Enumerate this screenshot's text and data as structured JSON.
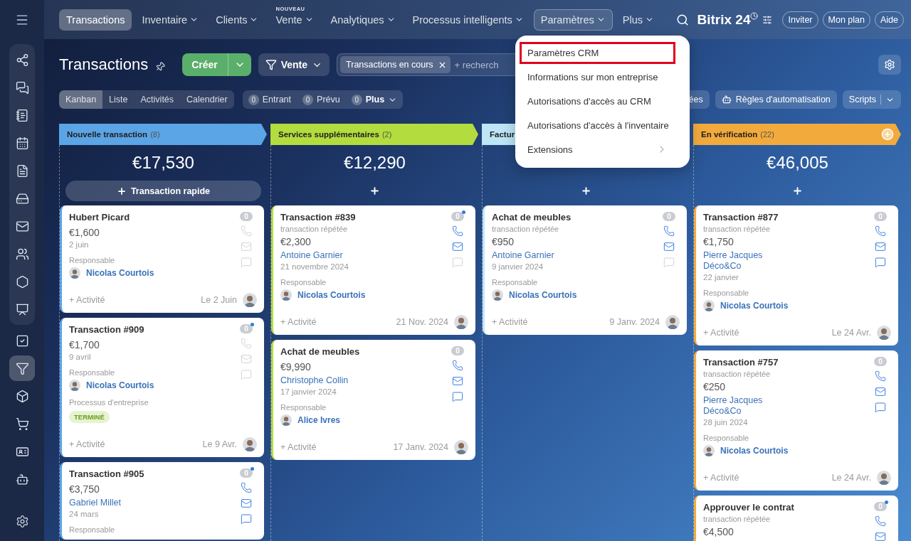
{
  "sidebar": {
    "items": [
      {
        "selected": false
      },
      {
        "selected": false
      },
      {
        "selected": false
      },
      {
        "selected": false
      },
      {
        "selected": false
      },
      {
        "selected": false
      },
      {
        "selected": false
      },
      {
        "selected": false
      },
      {
        "selected": false
      },
      {
        "selected": false
      },
      {
        "selected": false
      },
      {
        "selected": true
      },
      {
        "selected": false
      },
      {
        "selected": false
      },
      {
        "selected": false
      },
      {
        "selected": false
      }
    ]
  },
  "top_nav": {
    "items": [
      {
        "label": "Transactions",
        "selected": true,
        "expanded": false,
        "dropdown": false
      },
      {
        "label": "Inventaire",
        "selected": false,
        "expanded": false,
        "dropdown": true
      },
      {
        "label": "Clients",
        "selected": false,
        "expanded": false,
        "dropdown": true
      },
      {
        "label": "Vente",
        "selected": false,
        "expanded": false,
        "dropdown": true,
        "badge": "NOUVEAU"
      },
      {
        "label": "Analytiques",
        "selected": false,
        "expanded": false,
        "dropdown": true
      },
      {
        "label": "Processus intelligents",
        "selected": false,
        "expanded": false,
        "dropdown": true
      },
      {
        "label": "Paramètres",
        "selected": false,
        "expanded": true,
        "dropdown": true
      },
      {
        "label": "Plus",
        "selected": false,
        "expanded": false,
        "dropdown": true
      }
    ],
    "logo": "Bitrix 24",
    "buttons": [
      "Inviter",
      "Mon plan",
      "Aide"
    ]
  },
  "header": {
    "title": "Transactions",
    "create_button": "Créer",
    "pipeline_button": "Vente",
    "filter": {
      "chip": "Transactions en cours",
      "placeholder": "+ recherch"
    }
  },
  "view_tabs": [
    {
      "label": "Kanban",
      "selected": true
    },
    {
      "label": "Liste",
      "selected": false
    },
    {
      "label": "Activités",
      "selected": false
    },
    {
      "label": "Calendrier",
      "selected": false
    }
  ],
  "counters": [
    {
      "count": "0",
      "label": "Entrant",
      "dropdown": false
    },
    {
      "count": "0",
      "label": "Prévu",
      "dropdown": false
    },
    {
      "count": "0",
      "label": "Plus",
      "dropdown": true
    }
  ],
  "toolbar_buttons": [
    {
      "kind": "plain",
      "label": "ées"
    },
    {
      "kind": "robot",
      "label": "Règles d'automatisation"
    },
    {
      "kind": "split",
      "label": "Scripts"
    }
  ],
  "columns": [
    {
      "title": "Nouvelle transaction",
      "count": "(8)",
      "color": "#5ba4e6",
      "add_icon": false,
      "total": "€17,530",
      "add_label": "Transaction rapide",
      "cards": [
        {
          "title": "Hubert Picard",
          "amount": "€1,600",
          "date": "2 juin",
          "responsible_label": "Responsable",
          "responsible": "Nicolas Courtois",
          "activity": "+ Activité",
          "footer_date": "Le 2 Juin",
          "counter": "0",
          "unread": false,
          "phone": false,
          "mail": false,
          "chat": false
        },
        {
          "title": "Transaction #909",
          "amount": "€1,700",
          "date": "9 avril",
          "responsible_label": "Responsable",
          "responsible": "Nicolas Courtois",
          "process_label": "Processus d'entreprise",
          "process_status": "TERMINÉ",
          "activity": "+ Activité",
          "footer_date": "Le 9 Avr.",
          "counter": "0",
          "unread": true,
          "phone": false,
          "mail": false,
          "chat": false
        },
        {
          "title": "Transaction #905",
          "amount": "€3,750",
          "contacts": [
            "Gabriel Millet"
          ],
          "date": "24 mars",
          "responsible_label": "Responsable",
          "counter": "0",
          "unread": true,
          "phone": true,
          "mail": true,
          "chat": true
        }
      ]
    },
    {
      "title": "Services supplémentaires",
      "count": "(2)",
      "color": "#b3dc3e",
      "add_icon": false,
      "total": "€12,290",
      "cards": [
        {
          "title": "Transaction #839",
          "subtitle": "transaction répétée",
          "amount": "€2,300",
          "contacts": [
            "Antoine Garnier"
          ],
          "date": "21 novembre 2024",
          "responsible_label": "Responsable",
          "responsible": "Nicolas Courtois",
          "activity": "+ Activité",
          "footer_date": "21 Nov. 2024",
          "counter": "0",
          "unread": true,
          "phone": true,
          "mail": true,
          "chat": false
        },
        {
          "title": "Achat de meubles",
          "amount": "€9,990",
          "contacts": [
            "Christophe Collin"
          ],
          "date": "17 janvier 2024",
          "responsible_label": "Responsable",
          "responsible": "Alice Ivres",
          "activity": "+ Activité",
          "footer_date": "17 Janv. 2024",
          "counter": "0",
          "unread": false,
          "phone": true,
          "mail": true,
          "chat": true
        }
      ]
    },
    {
      "title": "Factur",
      "color": "#bde6f7",
      "add_icon": false,
      "cards": [
        {
          "title": "Achat de meubles",
          "subtitle": "transaction répétée",
          "amount": "€950",
          "contacts": [
            "Antoine Garnier"
          ],
          "date": "9 janvier 2024",
          "responsible_label": "Responsable",
          "responsible": "Nicolas Courtois",
          "activity": "+ Activité",
          "footer_date": "9 Janv. 2024",
          "counter": "0",
          "unread": false,
          "phone": true,
          "mail": true,
          "chat": false
        }
      ]
    },
    {
      "title": "En vérification",
      "count": "(22)",
      "color": "#f2aa3c",
      "add_icon": true,
      "total": "€46,005",
      "cards": [
        {
          "title": "Transaction #877",
          "subtitle": "transaction répétée",
          "amount": "€1,750",
          "contacts": [
            "Pierre Jacques",
            "Déco&Co"
          ],
          "date": "22 janvier",
          "responsible_label": "Responsable",
          "responsible": "Nicolas Courtois",
          "activity": "+ Activité",
          "footer_date": "Le 24 Avr.",
          "counter": "0",
          "unread": false,
          "phone": true,
          "mail": true,
          "chat": true
        },
        {
          "title": "Transaction #757",
          "subtitle": "transaction répétée",
          "amount": "€250",
          "contacts": [
            "Pierre Jacques",
            "Déco&Co"
          ],
          "date": "28 juin 2024",
          "responsible_label": "Responsable",
          "responsible": "Nicolas Courtois",
          "activity": "+ Activité",
          "footer_date": "Le 24 Avr.",
          "counter": "0",
          "unread": false,
          "phone": true,
          "mail": true,
          "chat": true
        },
        {
          "title": "Approuver le contrat",
          "subtitle": "transaction répétée",
          "amount": "€4,500",
          "counter": "0",
          "unread": true,
          "phone": true,
          "mail": true
        }
      ]
    }
  ],
  "menu": {
    "items": [
      {
        "label": "Paramètres CRM",
        "highlighted": true,
        "submenu": false
      },
      {
        "label": "Informations sur mon entreprise",
        "highlighted": false,
        "submenu": false
      },
      {
        "label": "Autorisations d'accès au CRM",
        "highlighted": false,
        "submenu": false
      },
      {
        "label": "Autorisations d'accès à l'inventaire",
        "highlighted": false,
        "submenu": false
      },
      {
        "label": "Extensions",
        "highlighted": false,
        "submenu": true
      }
    ]
  }
}
